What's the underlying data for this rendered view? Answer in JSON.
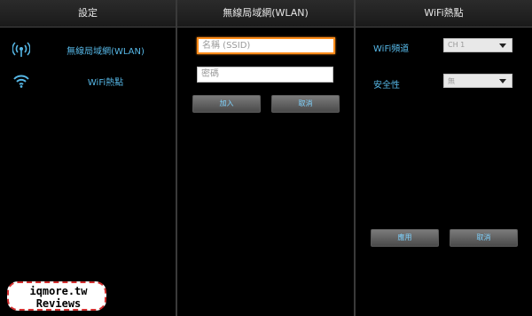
{
  "settings": {
    "title": "設定",
    "items": [
      {
        "label": "無線局域網(WLAN)",
        "icon": "wireless-antenna-icon"
      },
      {
        "label": "WiFi熱點",
        "icon": "wifi-icon"
      }
    ]
  },
  "wlan": {
    "title": "無線局域網(WLAN)",
    "ssid_placeholder": "名稱 (SSID)",
    "password_placeholder": "密碼",
    "join_label": "加入",
    "cancel_label": "取消"
  },
  "hotspot": {
    "title": "WiFi熱點",
    "channel_label": "WiFi頻道",
    "channel_value": "CH 1",
    "security_label": "安全性",
    "security_value": "無",
    "apply_label": "應用",
    "cancel_label": "取消"
  },
  "watermark": {
    "line1": "iqmore.tw",
    "line2": "Reviews"
  },
  "colors": {
    "accent": "#56b7e6",
    "focus": "#ff8c1a",
    "background": "#000000"
  }
}
